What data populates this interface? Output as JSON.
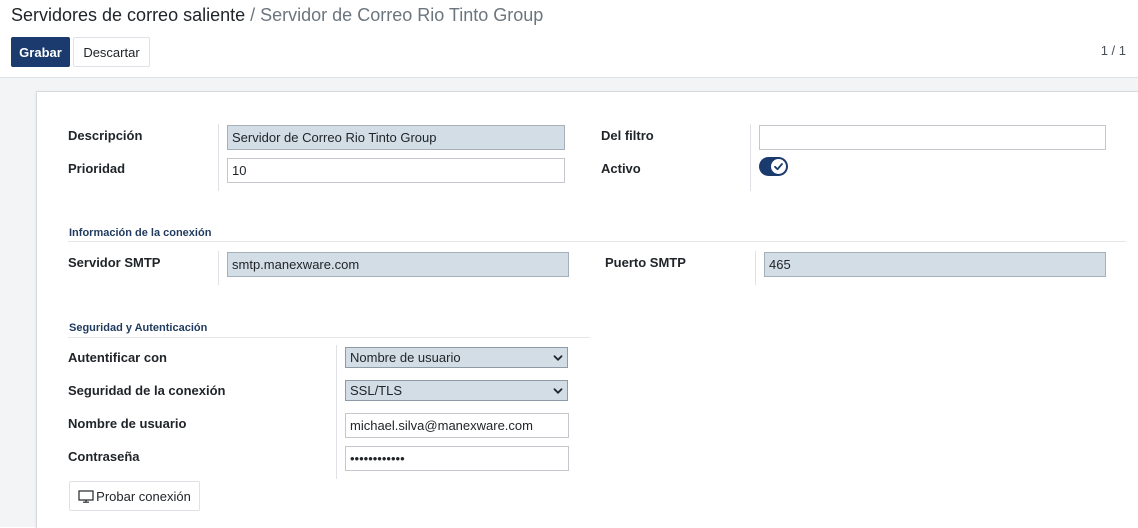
{
  "breadcrumb": {
    "parent": "Servidores de correo saliente",
    "separator": " / ",
    "current": "Servidor de Correo Rio Tinto Group"
  },
  "toolbar": {
    "save_label": "Grabar",
    "discard_label": "Descartar",
    "pager": "1 / 1"
  },
  "form": {
    "description": {
      "label": "Descripción",
      "value": "Servidor de Correo Rio Tinto Group"
    },
    "priority": {
      "label": "Prioridad",
      "value": "10"
    },
    "filter": {
      "label": "Del filtro",
      "value": ""
    },
    "active": {
      "label": "Activo",
      "checked": true
    },
    "connection": {
      "title": "Información de la conexión",
      "smtp_server": {
        "label": "Servidor SMTP",
        "value": "smtp.manexware.com"
      },
      "smtp_port": {
        "label": "Puerto SMTP",
        "value": "465"
      }
    },
    "security": {
      "title": "Seguridad y Autenticación",
      "auth_with": {
        "label": "Autentificar con",
        "value": "Nombre de usuario"
      },
      "conn_security": {
        "label": "Seguridad de la conexión",
        "value": "SSL/TLS"
      },
      "username": {
        "label": "Nombre de usuario",
        "value": "michael.silva@manexware.com"
      },
      "password": {
        "label": "Contraseña",
        "value": "••••••••••••"
      }
    },
    "test_button": {
      "label": "Probar conexión",
      "icon": "monitor-icon"
    }
  },
  "colors": {
    "primary": "#1b3a6d",
    "required_field_bg": "#d2dde6"
  }
}
